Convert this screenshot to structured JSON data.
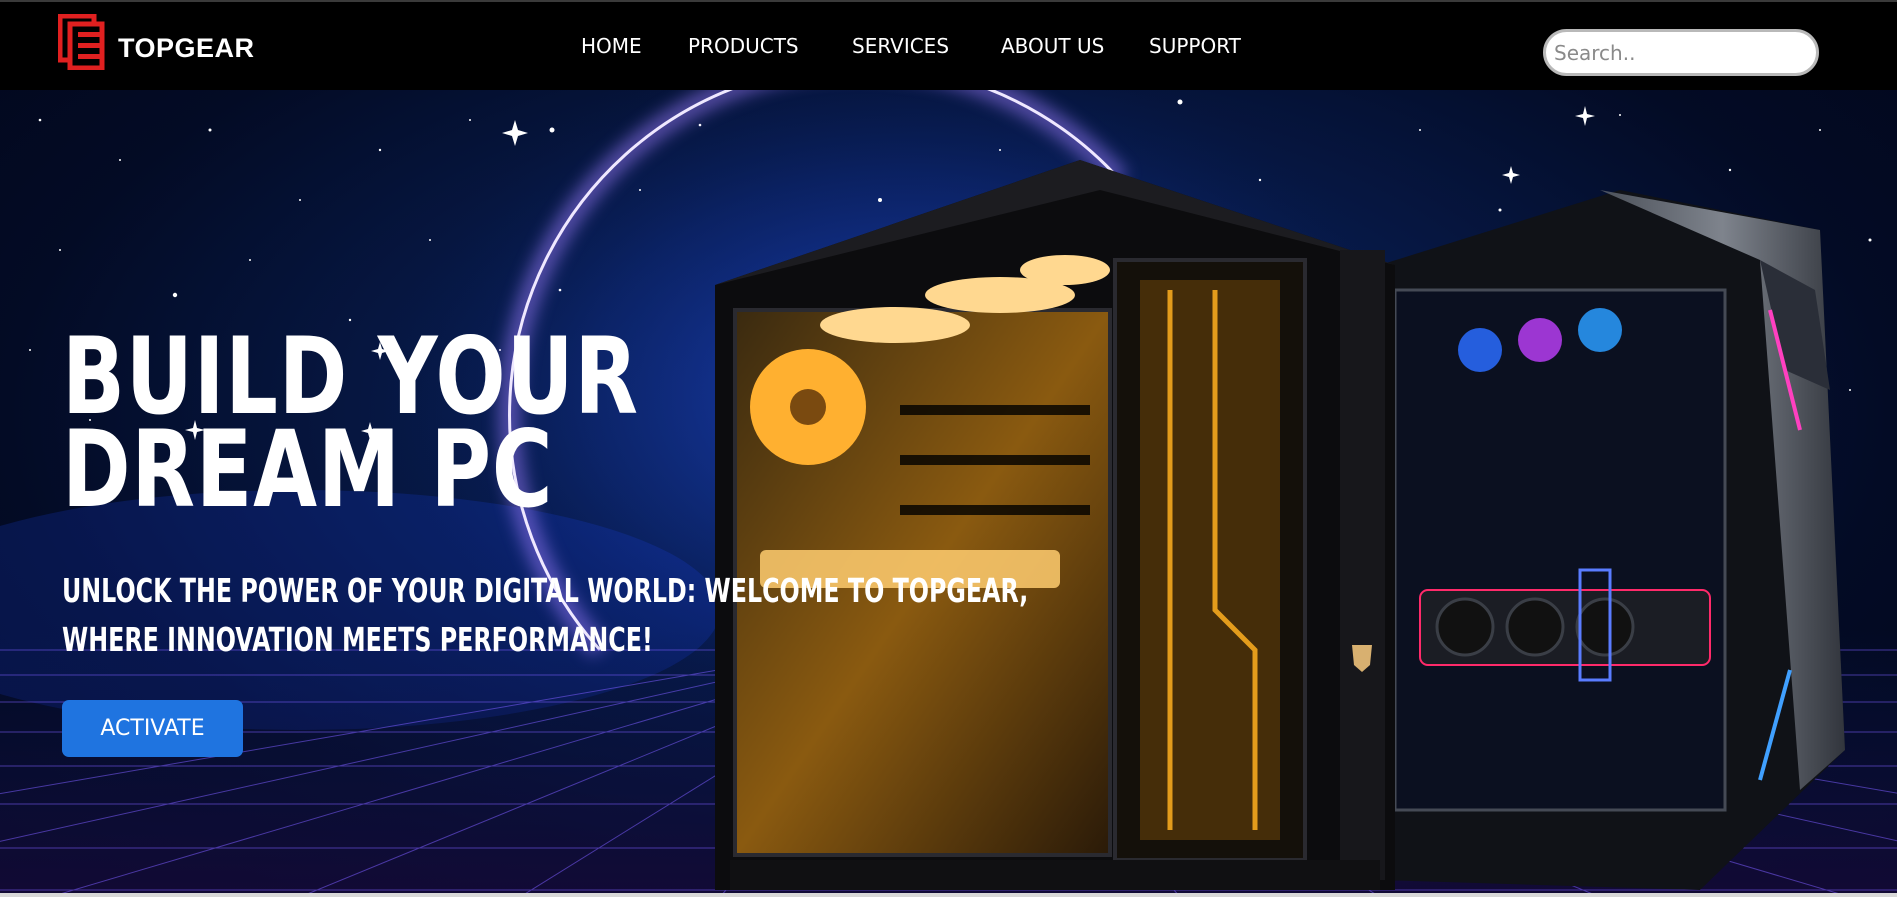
{
  "brand": {
    "name": "TOPGEAR",
    "accent": "#e02020"
  },
  "nav": [
    {
      "label": "HOME"
    },
    {
      "label": "PRODUCTS"
    },
    {
      "label": "SERVICES"
    },
    {
      "label": "ABOUT US"
    },
    {
      "label": "SUPPORT"
    }
  ],
  "search": {
    "placeholder": "Search..",
    "value": ""
  },
  "hero": {
    "title_line1": "BUILD YOUR",
    "title_line2": "DREAM PC",
    "subtitle_line1": "UNLOCK THE POWER OF YOUR DIGITAL WORLD: WELCOME TO TOPGEAR,",
    "subtitle_line2": "WHERE INNOVATION MEETS PERFORMANCE!",
    "cta_label": "ACTIVATE",
    "cta_color": "#1f74e0",
    "background_color": "#061a4d",
    "glow_color": "#b8a0ff"
  },
  "images": [
    {
      "name": "pc-case-black-icon",
      "description": ""
    },
    {
      "name": "pc-case-silver-icon",
      "description": ""
    }
  ]
}
